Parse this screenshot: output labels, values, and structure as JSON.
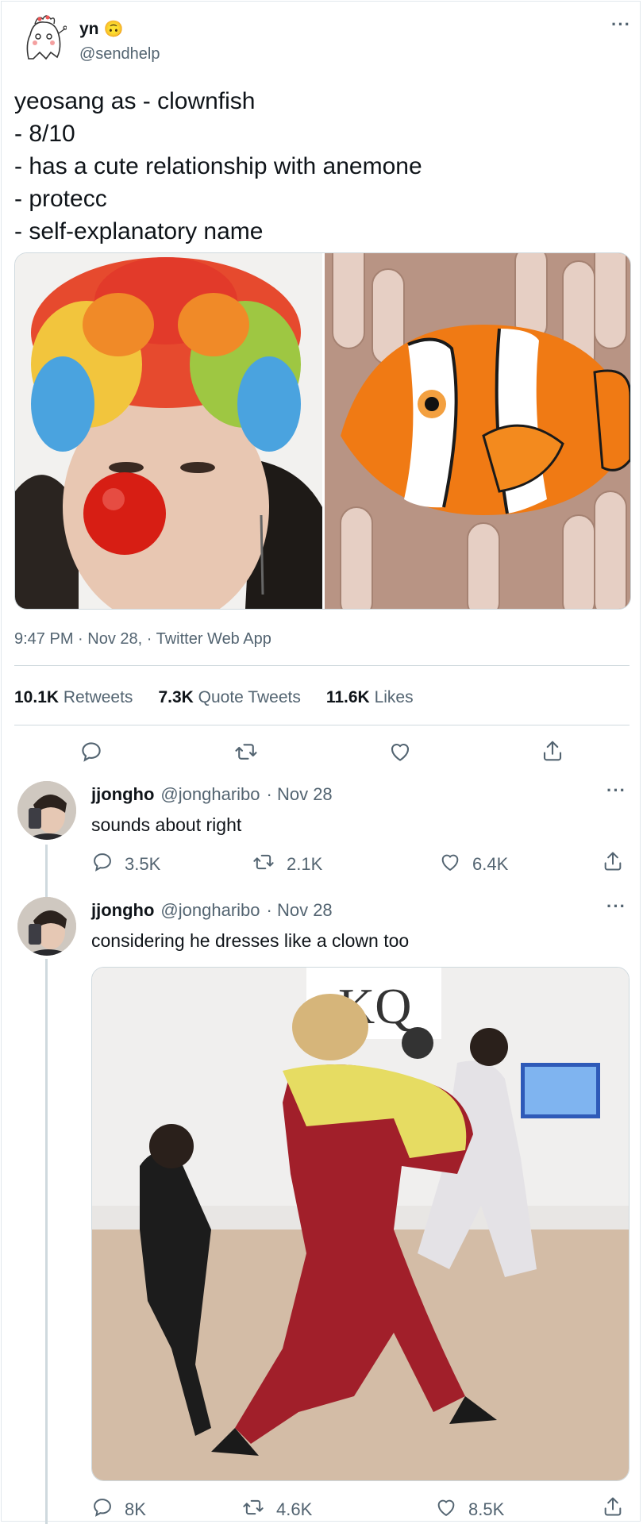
{
  "main_tweet": {
    "author_name": "yn",
    "author_emoji": "🙃",
    "author_handle": "@sendhelp",
    "text": "yeosang as - clownfish\n- 8/10\n- has a cute relationship with anemone\n- protecc\n- self-explanatory name",
    "timestamp": "9:47 PM · Nov 28, · Twitter Web App",
    "stats": {
      "retweets_count": "10.1K",
      "retweets_label": "Retweets",
      "quotes_count": "7.3K",
      "quotes_label": "Quote Tweets",
      "likes_count": "11.6K",
      "likes_label": "Likes"
    }
  },
  "replies": [
    {
      "author_name": "jjongho",
      "author_handle": "@jongharibo",
      "date": "· Nov 28",
      "text": "sounds about right",
      "reply_count": "3.5K",
      "retweet_count": "2.1K",
      "like_count": "6.4K"
    },
    {
      "author_name": "jjongho",
      "author_handle": "@jongharibo",
      "date": "· Nov 28",
      "text": "considering he dresses like a clown too",
      "reply_count": "8K",
      "retweet_count": "4.6K",
      "like_count": "8.5K",
      "media_overlay_text": "KQ"
    }
  ],
  "icons": [
    "more-icon",
    "reply-icon",
    "retweet-icon",
    "like-icon",
    "share-icon"
  ],
  "colors": {
    "text": "#0f1419",
    "secondary": "#536471",
    "border": "#cfd9de"
  }
}
